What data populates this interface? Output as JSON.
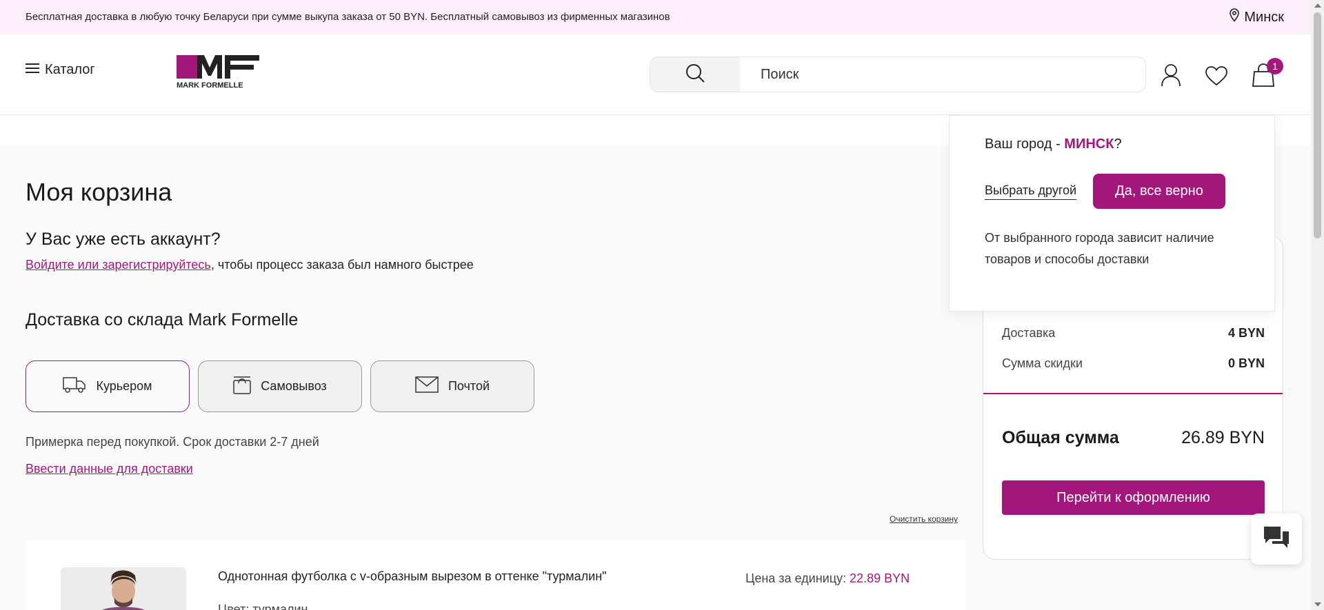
{
  "topbar": {
    "promo": "Бесплатная доставка в любую точку Беларуси при сумме выкупа заказа от 50 BYN. Бесплатный самовывоз из фирменных магазинов",
    "city": "Минск"
  },
  "header": {
    "catalog_label": "Каталог",
    "logo_text": "MARK FORMELLE",
    "search_placeholder": "Поиск",
    "cart_count": "1"
  },
  "cart": {
    "title": "Моя корзина",
    "account_heading": "У Вас уже есть аккаунт?",
    "login_link": "Войдите или зарегистрируйтесь",
    "login_suffix": ", чтобы процесс заказа был намного быстрее",
    "delivery_heading": "Доставка со склада Mark Formelle",
    "delivery_tabs": [
      {
        "label": "Курьером",
        "icon": "truck-icon",
        "active": true
      },
      {
        "label": "Самовывоз",
        "icon": "shopping-bag-icon",
        "active": false
      },
      {
        "label": "Почтой",
        "icon": "envelope-icon",
        "active": false
      }
    ],
    "delivery_note": "Примерка перед покупкой. Срок доставки 2-7 дней",
    "delivery_link": "Ввести данные для доставки",
    "clear_cart": "Очистить корзину",
    "item": {
      "name": "Однотонная футболка с v-образным вырезом в оттенке \"турмалин\"",
      "color": "Цвет: турмалин",
      "price_label": "Цена за единицу:",
      "price_value": "22.89 BYN"
    }
  },
  "summary": {
    "delivery_label": "Доставка",
    "delivery_value": "4 BYN",
    "discount_label": "Сумма скидки",
    "discount_value": "0 BYN",
    "total_label": "Общая сумма",
    "total_value": "26.89 BYN",
    "checkout_label": "Перейти к оформлению"
  },
  "city_popup": {
    "question_prefix": "Ваш город - ",
    "city": "МИНСК",
    "question_suffix": "?",
    "choose_other": "Выбрать другой",
    "confirm": "Да, все верно",
    "hint": "От выбранного города зависит наличие товаров и способы доставки"
  },
  "colors": {
    "accent": "#a3177c",
    "topbar_bg": "#fdeefb",
    "page_bg": "#fafafa"
  }
}
